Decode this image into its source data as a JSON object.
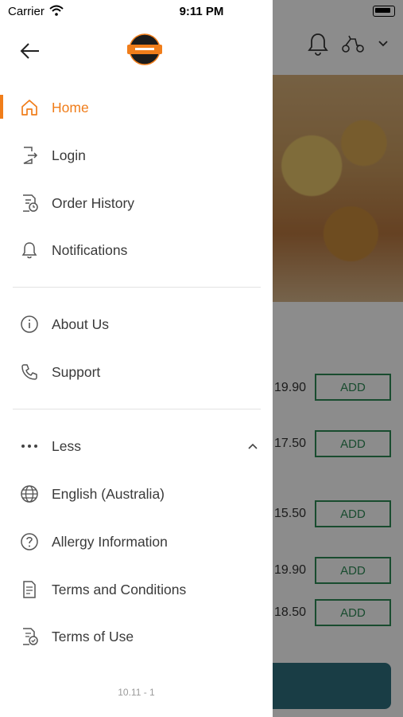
{
  "status_bar": {
    "carrier": "Carrier",
    "time": "9:11 PM"
  },
  "drawer": {
    "nav_primary": [
      {
        "label": "Home",
        "icon": "home-icon",
        "active": true
      },
      {
        "label": "Login",
        "icon": "login-icon"
      },
      {
        "label": "Order History",
        "icon": "order-history-icon"
      },
      {
        "label": "Notifications",
        "icon": "bell-icon"
      }
    ],
    "nav_secondary": [
      {
        "label": "About Us",
        "icon": "info-icon"
      },
      {
        "label": "Support",
        "icon": "phone-icon"
      }
    ],
    "more_toggle": {
      "label": "Less",
      "icon": "ellipsis-icon"
    },
    "nav_more": [
      {
        "label": "English (Australia)",
        "icon": "globe-icon"
      },
      {
        "label": "Allergy Information",
        "icon": "question-icon"
      },
      {
        "label": "Terms and Conditions",
        "icon": "document-icon"
      },
      {
        "label": "Terms of Use",
        "icon": "document-check-icon"
      }
    ],
    "version": "10.11 - 1"
  },
  "background": {
    "prices": [
      "19.90",
      "17.50",
      "15.50",
      "19.90",
      "18.50"
    ],
    "add_label": "ADD"
  },
  "colors": {
    "accent": "#f07d1a",
    "add_green": "#2e8b57",
    "cart_bar": "#2f6f7e"
  }
}
